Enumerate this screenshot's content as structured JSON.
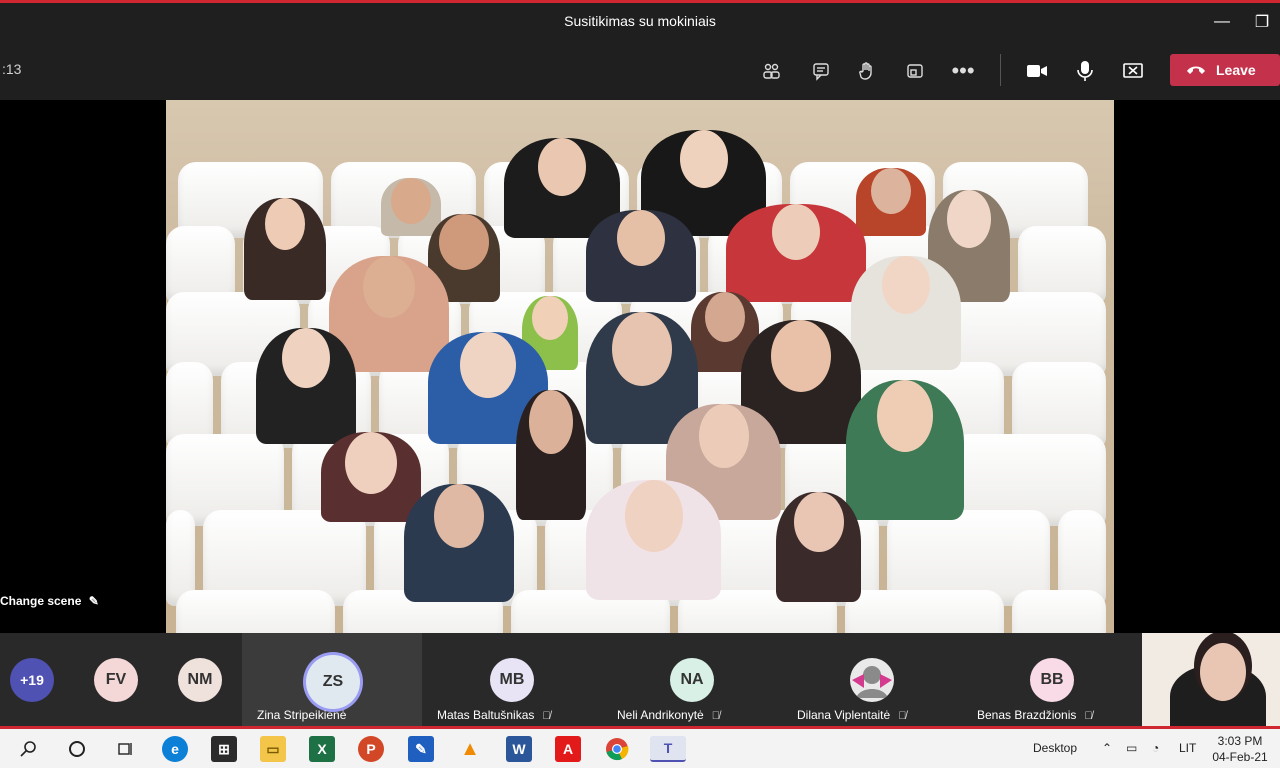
{
  "window": {
    "title": "Susitikimas su mokiniais",
    "minimize": "—",
    "maximize": "❐"
  },
  "toolbar": {
    "timer": ":13",
    "leave_label": "Leave"
  },
  "scene": {
    "change_scene_label": "Change scene"
  },
  "participants": [
    {
      "initials": "+19",
      "name": "",
      "color": "#4f52b2",
      "text_color": "#ffffff"
    },
    {
      "initials": "FV",
      "name": "",
      "color": "#f4d7d7",
      "text_color": "#333333"
    },
    {
      "initials": "NM",
      "name": "",
      "color": "#efe1dc",
      "text_color": "#333333"
    },
    {
      "initials": "ZS",
      "name": "Zina Stripeikienė",
      "color": "#e0e9ef",
      "text_color": "#333333",
      "muted": false
    },
    {
      "initials": "MB",
      "name": "Matas Baltušnikas",
      "color": "#e8e4f5",
      "text_color": "#333333",
      "muted": true
    },
    {
      "initials": "NA",
      "name": "Neli Andrikonytė",
      "color": "#d9f0e6",
      "text_color": "#333333",
      "muted": true
    },
    {
      "initials": "",
      "name": "Dilana Viplentaitė",
      "color": "#e9e9e9",
      "text_color": "#333333",
      "muted": true
    },
    {
      "initials": "BB",
      "name": "Benas Brazdžionis",
      "color": "#f8dbe6",
      "text_color": "#333333",
      "muted": true
    }
  ],
  "taskbar": {
    "desktop_label": "Desktop",
    "lang": "LIT",
    "time": "3:03 PM",
    "date": "04-Feb-21"
  },
  "colors": {
    "leave": "#c4314b",
    "accent_border": "#d0262f",
    "speaking_ring": "#9a9cf4"
  }
}
